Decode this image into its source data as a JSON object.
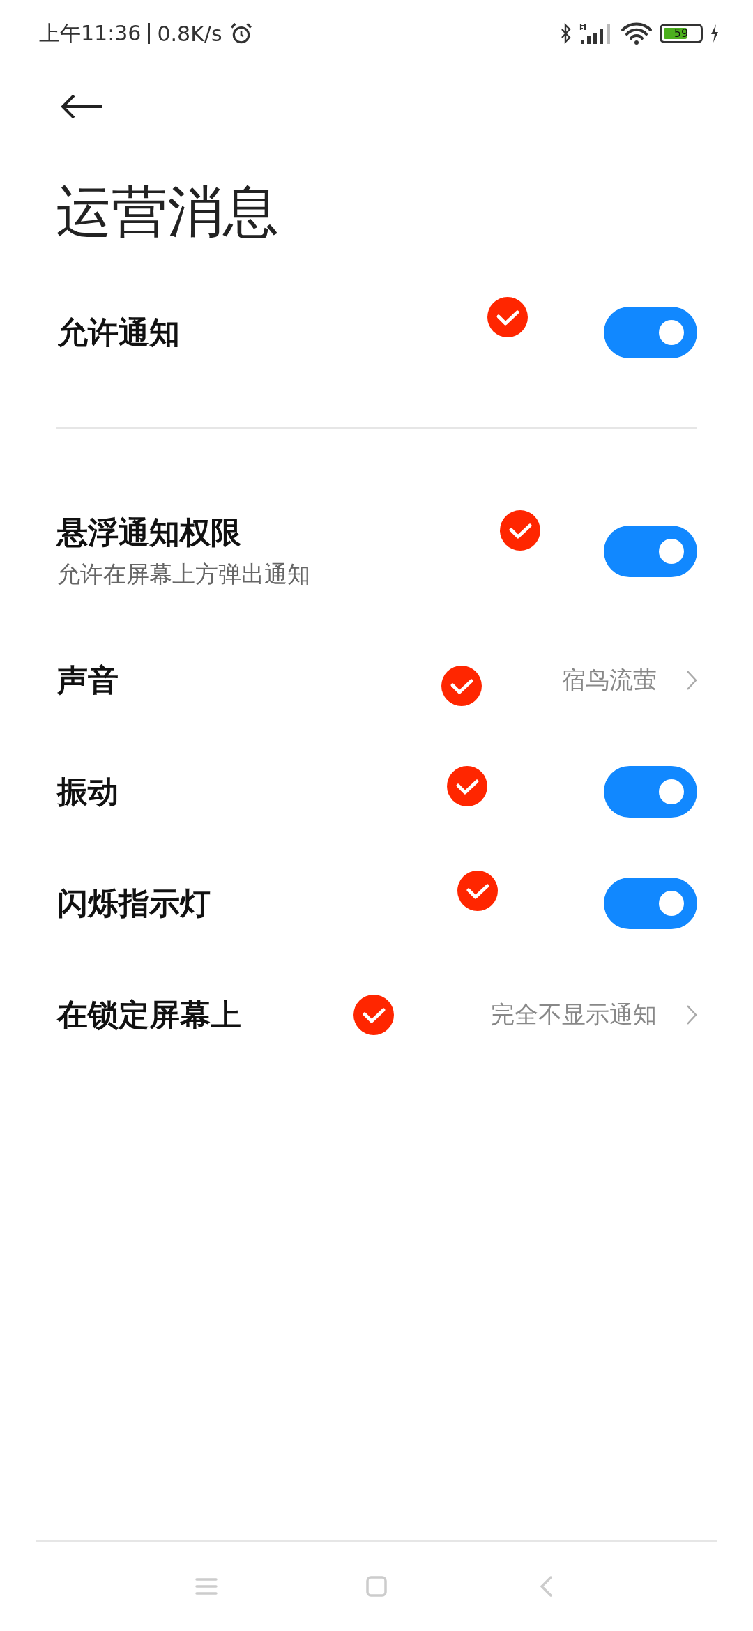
{
  "status_bar": {
    "time": "上午11:36",
    "speed": "0.8K/s",
    "battery": "59"
  },
  "title": "运营消息",
  "settings": [
    {
      "kind": "toggle",
      "label": "允许通知",
      "on": true,
      "marked": true,
      "divider_after": true
    },
    {
      "kind": "toggle",
      "label": "悬浮通知权限",
      "subtitle": "允许在屏幕上方弹出通知",
      "on": true,
      "marked": true
    },
    {
      "kind": "link",
      "label": "声音",
      "value": "宿鸟流萤",
      "marked": true
    },
    {
      "kind": "toggle",
      "label": "振动",
      "on": true,
      "marked": true
    },
    {
      "kind": "toggle",
      "label": "闪烁指示灯",
      "on": true,
      "marked": true
    },
    {
      "kind": "link",
      "label": "在锁定屏幕上",
      "value": "完全不显示通知",
      "marked": true
    }
  ]
}
